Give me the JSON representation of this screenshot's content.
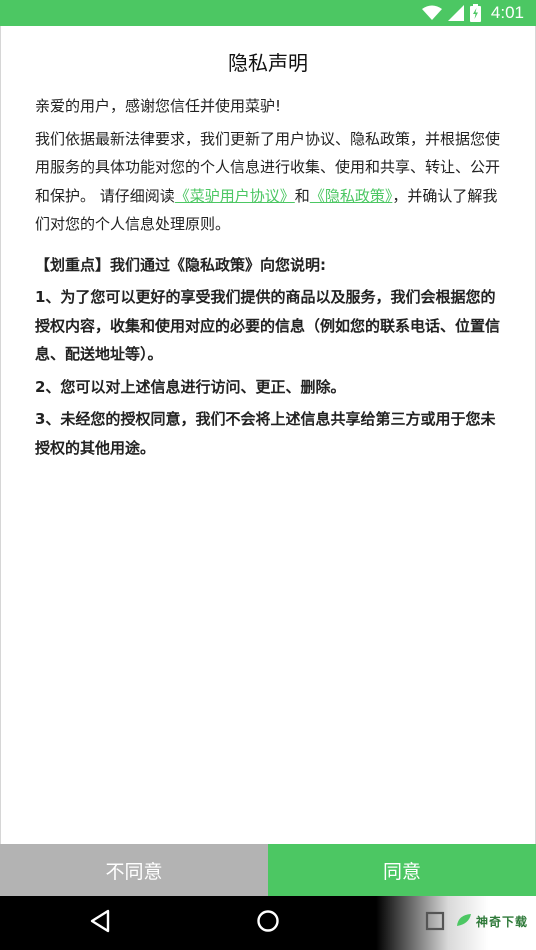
{
  "status_bar": {
    "time": "4:01",
    "icons": [
      "wifi-icon",
      "cellular-signal-icon",
      "battery-charging-icon"
    ]
  },
  "dialog": {
    "title": "隐私声明",
    "greeting": "亲爱的用户，感谢您信任并使用菜驴!",
    "intro_part1": "我们依据最新法律要求，我们更新了用户协议、隐私政策，并根据您使用服务的具体功能对您的个人信息进行收集、使用和共享、转让、公开和保护。 请仔细阅读",
    "user_agreement_link": "《菜驴用户协议》",
    "intro_and": "和",
    "privacy_policy_link": "《隐私政策》",
    "intro_part2": "，并确认了解我们对您的个人信息处理原则。",
    "highlight_heading": "【划重点】我们通过《隐私政策》向您说明:",
    "points": [
      "1、为了您可以更好的享受我们提供的商品以及服务，我们会根据您的授权内容，收集和使用对应的必要的信息（例如您的联系电话、位置信息、配送地址等）。",
      "2、您可以对上述信息进行访问、更正、删除。",
      "3、未经您的授权同意，我们不会将上述信息共享给第三方或用于您未授权的其他用途。"
    ]
  },
  "buttons": {
    "disagree_label": "不同意",
    "agree_label": "同意"
  },
  "nav_bar": {
    "icons": [
      "back-icon",
      "home-icon",
      "recent-apps-icon"
    ]
  },
  "watermark": {
    "text": "神奇下载"
  },
  "colors": {
    "accent": "#4cc763",
    "disagree_bg": "#b3b3b3",
    "nav_bg": "#000000"
  }
}
